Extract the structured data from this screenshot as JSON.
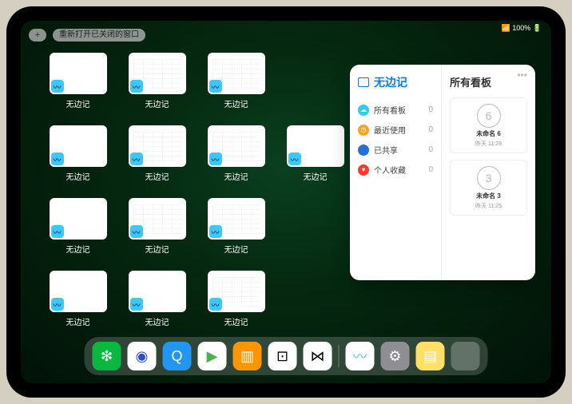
{
  "status": {
    "indicators": "📶 100% 🔋"
  },
  "top": {
    "plus": "+",
    "reopen_label": "重新打开已关闭的窗口"
  },
  "windows": {
    "label": "无边记",
    "items": [
      {
        "type": "blank"
      },
      {
        "type": "grid"
      },
      {
        "type": "grid"
      },
      {
        "type": "blank"
      },
      {
        "type": "grid"
      },
      {
        "type": "grid"
      },
      {
        "type": "blank"
      },
      {
        "type": "blank"
      },
      {
        "type": "grid"
      },
      {
        "type": "grid"
      },
      {
        "type": "blank"
      },
      {
        "type": "blank"
      },
      {
        "type": "grid"
      }
    ]
  },
  "panel": {
    "left_title": "无边记",
    "nav": [
      {
        "icon_color": "#34c7f9",
        "glyph": "☁",
        "label": "所有看板",
        "count": "0"
      },
      {
        "icon_color": "#f7a623",
        "glyph": "◷",
        "label": "最近使用",
        "count": "0"
      },
      {
        "icon_color": "#2a6fd6",
        "glyph": "👤",
        "label": "已共享",
        "count": "0"
      },
      {
        "icon_color": "#ff3b30",
        "glyph": "♥",
        "label": "个人收藏",
        "count": "0"
      }
    ],
    "right_title": "所有看板",
    "boards": [
      {
        "sketch": "6",
        "name": "未命名 6",
        "date": "昨天 11:28"
      },
      {
        "sketch": "3",
        "name": "未命名 3",
        "date": "昨天 11:25"
      }
    ]
  },
  "dock": {
    "apps": [
      {
        "name": "wechat",
        "bg": "#09b83e",
        "glyph": "❇"
      },
      {
        "name": "quark",
        "bg": "#ffffff",
        "glyph": "◉",
        "fg": "#2b4dd1"
      },
      {
        "name": "qqbrowser",
        "bg": "#2196f3",
        "glyph": "Q"
      },
      {
        "name": "play",
        "bg": "#ffffff",
        "glyph": "▶",
        "fg": "#4caf50"
      },
      {
        "name": "books",
        "bg": "#ff9500",
        "glyph": "▥"
      },
      {
        "name": "dice",
        "bg": "#ffffff",
        "glyph": "⊡",
        "fg": "#000"
      },
      {
        "name": "connect",
        "bg": "#ffffff",
        "glyph": "⋈",
        "fg": "#000"
      },
      {
        "name": "freeform",
        "bg": "#ffffff",
        "glyph": "〰",
        "fg": "#3dc7ff"
      },
      {
        "name": "settings",
        "bg": "#8e8e93",
        "glyph": "⚙"
      },
      {
        "name": "notes",
        "bg": "#ffe066",
        "glyph": "▤",
        "fg": "#fff"
      }
    ]
  }
}
